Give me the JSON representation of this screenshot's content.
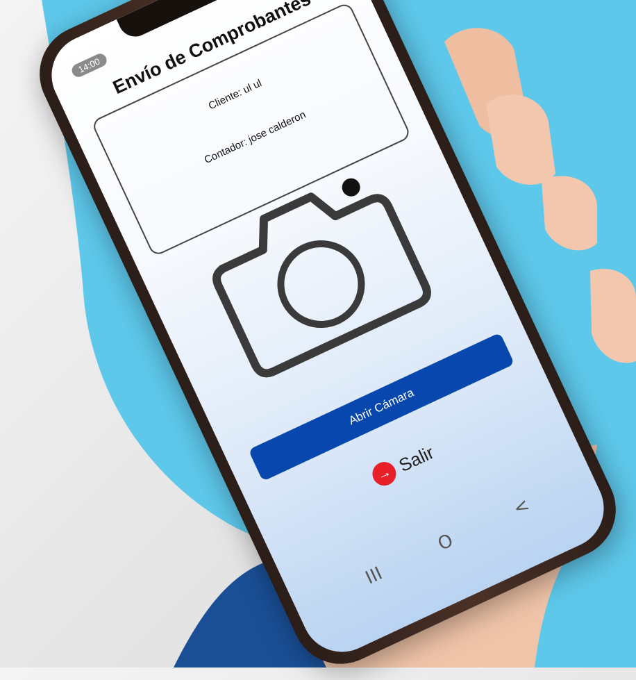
{
  "status_bar": {
    "time": "14:00"
  },
  "app": {
    "title": "Envío de Comprobantes",
    "client_label": "Cliente: ul ul",
    "accountant_label": "Contador: jose calderon",
    "open_camera_label": "Abrir Cámara",
    "exit_label": "Salir"
  },
  "nav": {
    "recent": "III",
    "home": "O",
    "back": "<"
  },
  "colors": {
    "background_blue": "#5ec8eb",
    "deep_blue": "#1a4f96",
    "button_blue": "#0847ad",
    "exit_red": "#e8202a"
  },
  "icons": {
    "camera": "camera-icon",
    "exit": "arrow-right-circle-icon"
  }
}
